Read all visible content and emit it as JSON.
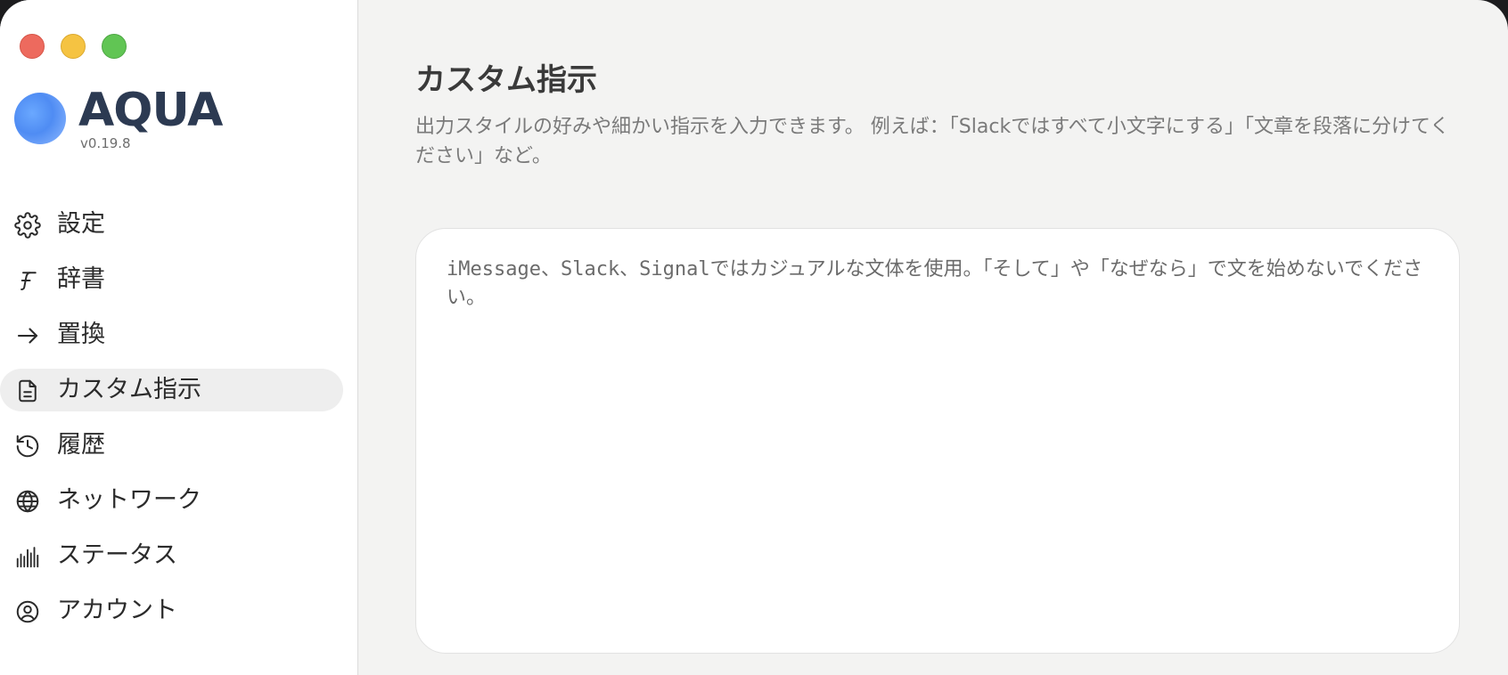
{
  "app": {
    "name": "AQUA",
    "version": "v0.19.8"
  },
  "sidebar": {
    "items": [
      {
        "label": "設定",
        "icon": "gear-icon",
        "active": false
      },
      {
        "label": "辞書",
        "icon": "script-f-icon",
        "active": false
      },
      {
        "label": "置換",
        "icon": "arrow-right-icon",
        "active": false
      },
      {
        "label": "カスタム指示",
        "icon": "document-icon",
        "active": true
      },
      {
        "label": "履歴",
        "icon": "history-icon",
        "active": false
      },
      {
        "label": "ネットワーク",
        "icon": "globe-icon",
        "active": false
      },
      {
        "label": "ステータス",
        "icon": "bars-icon",
        "active": false
      },
      {
        "label": "アカウント",
        "icon": "user-circle-icon",
        "active": false
      }
    ]
  },
  "main": {
    "title": "カスタム指示",
    "description": "出力スタイルの好みや細かい指示を入力できます。 例えば：「Slackではすべて小文字にする」「文章を段落に分けてください」など。",
    "editor_value": "iMessage、Slack、Signalではカジュアルな文体を使用。「そして」や「なぜなら」で文を始めないでください。"
  },
  "colors": {
    "accent": "#4f8cf3",
    "traffic_red": "#ed6a5e",
    "traffic_yellow": "#f5c342",
    "traffic_green": "#61c554",
    "active_bg": "#eeeeee"
  }
}
